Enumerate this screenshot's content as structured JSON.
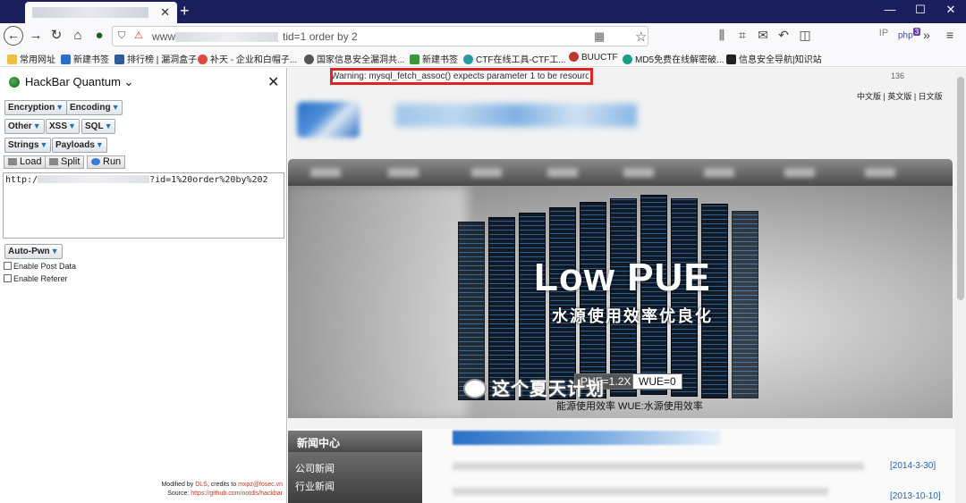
{
  "browser": {
    "tab_close": "✕",
    "new_tab": "+",
    "window_controls": [
      "—",
      "☐",
      "✕"
    ],
    "nav": {
      "back": "←",
      "forward": "→",
      "reload": "↻",
      "home": "⌂"
    },
    "url_prefix": "www.",
    "url_suffix": "tid=1 order by 2",
    "toolbar_right": {
      "ip": "IP",
      "php_badge": "3"
    },
    "bookmarks": [
      "常用网址",
      "新建书签",
      "排行榜 | 漏洞盒子",
      "补天 - 企业和白帽子...",
      "国家信息安全漏洞共...",
      "新建书签",
      "CTF在线工具-CTF工...",
      "BUUCTF",
      "MD5免费在线解密破...",
      "信息安全导航|知识站"
    ]
  },
  "hackbar": {
    "title": "HackBar Quantum ⌄",
    "close": "✕",
    "menus": {
      "encryption": "Encryption",
      "encoding": "Encoding",
      "other": "Other",
      "xss": "XSS",
      "sql": "SQL",
      "strings": "Strings",
      "payloads": "Payloads",
      "autopwn": "Auto-Pwn"
    },
    "actions": {
      "load": "Load",
      "split": "Split",
      "run": "Run"
    },
    "url_start": "http:/",
    "url_end": "?id=1%20order%20by%202",
    "enable_post": "Enable Post Data",
    "enable_referer": "Enable Referer",
    "footer_modified": "Modified by",
    "footer_dls": "DLS",
    "footer_credits": ", credits to",
    "footer_mxp": "mxpz@fosec.vn",
    "footer_source": "Source:",
    "footer_link": "https://github.com/notdls/hackbar"
  },
  "page": {
    "warning": "Warning: mysql_fetch_assoc() expects parameter 1 to be resource",
    "counter": "136",
    "languages": "中文版  |  英文版  |  日文版",
    "banner_title": "Low PUE",
    "banner_subtitle": "水源使用效率优良化",
    "pue_value": "PUE=1.2X",
    "wue_value": "WUE=0",
    "banner_caption": "能源使用效率  WUE:水源使用效率",
    "news_title": "新闻中心",
    "news_links": [
      "公司新闻",
      "行业新闻"
    ],
    "news_dates": [
      "[2014-3-30]",
      "[2013-10-10]"
    ],
    "watermark": "这个夏天计划"
  }
}
